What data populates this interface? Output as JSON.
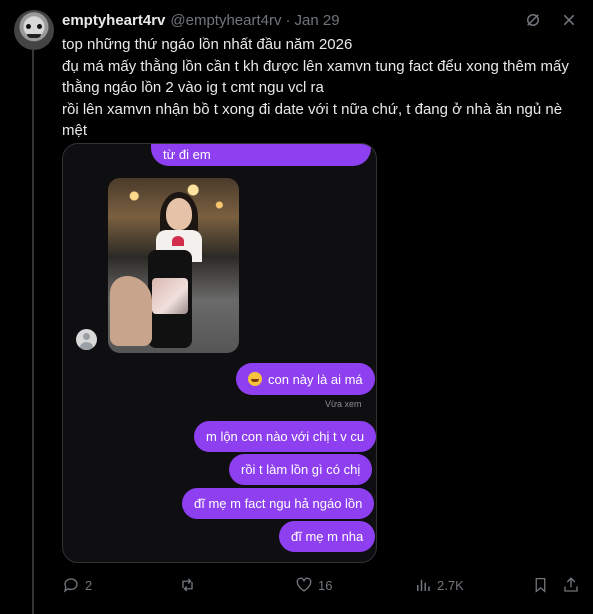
{
  "tweet": {
    "display_name": "emptyheart4rv",
    "handle": "@emptyheart4rv",
    "separator": "·",
    "time": "Jan 29",
    "text_lines": [
      "top những thứ ngáo lồn nhất đầu năm 2026",
      "đụ má mấy thằng lồn cần t kh được lên xamvn tung fact đểu xong thêm mấy",
      "thằng ngáo lồn 2 vào ig t cmt ngu vcl ra",
      "rồi lên xamvn nhận bồ t xong đi date với t nữa chứ, t đang ở nhà ăn ngủ nè",
      "mệt"
    ]
  },
  "top_icons": [
    "grok-icon",
    "close-icon"
  ],
  "chat": {
    "top_message": "từ đi em",
    "messages": [
      "con này là ai má",
      "m lộn con nào với chị t v cu",
      "rồi t làm lồn gì có chị",
      "đĩ mẹ m fact ngu hả ngáo lồn",
      "đĩ mẹ m nha"
    ],
    "seen_label": "Vừa xem",
    "bubble_color": "#8e3ff0"
  },
  "actions": {
    "replies": "2",
    "reposts": "",
    "likes": "16",
    "views": "2.7K"
  },
  "colors": {
    "background": "#000000",
    "text": "#e7e9ea",
    "muted": "#71767b"
  }
}
